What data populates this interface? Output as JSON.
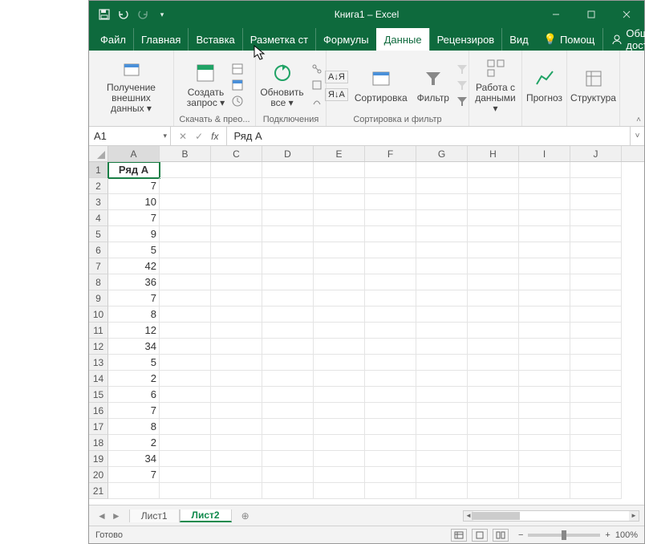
{
  "title": "Книга1 – Excel",
  "tabs": {
    "file": "Файл",
    "home": "Главная",
    "insert": "Вставка",
    "pagelayout": "Разметка ст",
    "formulas": "Формулы",
    "data": "Данные",
    "review": "Рецензиров",
    "view": "Вид",
    "help": "Помощ",
    "share": "Общий доступ"
  },
  "ribbon": {
    "getdata": {
      "big": "Получение\nвнешних данных ▾",
      "label": ""
    },
    "newquery": {
      "big": "Создать\nзапрос ▾",
      "label": "Скачать & прео..."
    },
    "refresh": {
      "big": "Обновить\nвсе ▾",
      "label": "Подключения"
    },
    "sortAZ": "А↓Я",
    "sortZA": "Я↓А",
    "sort": {
      "big": "Сортировка"
    },
    "filter": {
      "big": "Фильтр"
    },
    "sortfilter_label": "Сортировка и фильтр",
    "datatools": {
      "big": "Работа с\nданными ▾"
    },
    "forecast": {
      "big": "Прогноз"
    },
    "outline": {
      "big": "Структура"
    }
  },
  "namebox": "A1",
  "formula": "Ряд A",
  "columns": [
    "A",
    "B",
    "C",
    "D",
    "E",
    "F",
    "G",
    "H",
    "I",
    "J"
  ],
  "chart_data": {
    "type": "table",
    "header": "Ряд A",
    "rows": [
      {
        "n": 1,
        "a": "Ряд A"
      },
      {
        "n": 2,
        "a": "7"
      },
      {
        "n": 3,
        "a": "10"
      },
      {
        "n": 4,
        "a": "7"
      },
      {
        "n": 5,
        "a": "9"
      },
      {
        "n": 6,
        "a": "5"
      },
      {
        "n": 7,
        "a": "42"
      },
      {
        "n": 8,
        "a": "36"
      },
      {
        "n": 9,
        "a": "7"
      },
      {
        "n": 10,
        "a": "8"
      },
      {
        "n": 11,
        "a": "12"
      },
      {
        "n": 12,
        "a": "34"
      },
      {
        "n": 13,
        "a": "5"
      },
      {
        "n": 14,
        "a": "2"
      },
      {
        "n": 15,
        "a": "6"
      },
      {
        "n": 16,
        "a": "7"
      },
      {
        "n": 17,
        "a": "8"
      },
      {
        "n": 18,
        "a": "2"
      },
      {
        "n": 19,
        "a": "34"
      },
      {
        "n": 20,
        "a": "7"
      }
    ]
  },
  "sheets": {
    "s1": "Лист1",
    "s2": "Лист2"
  },
  "status": "Готово",
  "zoom": "100%"
}
